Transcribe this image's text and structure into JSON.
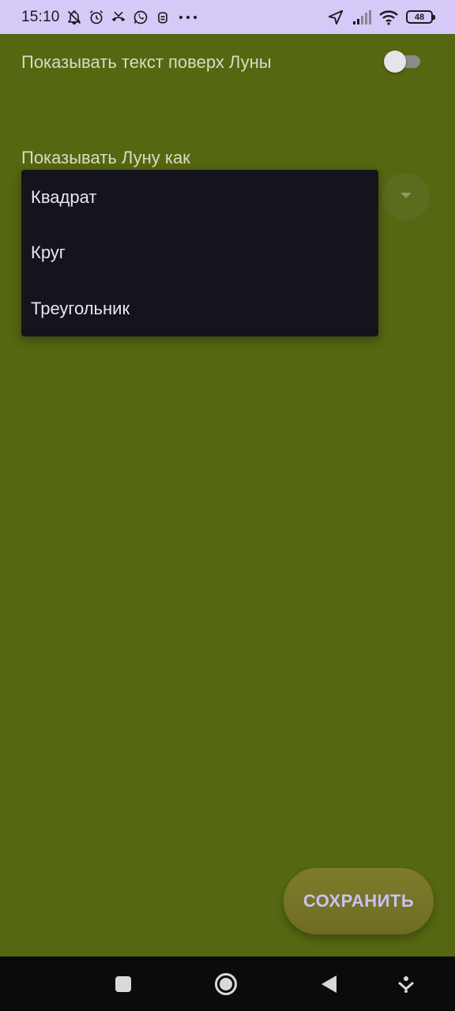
{
  "status_bar": {
    "time": "15:10",
    "battery": "48",
    "left_icons": [
      "bell-off-icon",
      "alarm-icon",
      "missed-call-icon",
      "whatsapp-icon",
      "chat-bot-icon",
      "more-dots-icon"
    ],
    "right_icons": [
      "location-arrow-icon",
      "cell-signal-icon",
      "wifi-icon",
      "battery-icon"
    ]
  },
  "settings": {
    "show_text_over_moon": {
      "label": "Показывать текст поверх Луны",
      "enabled": false
    },
    "show_moon_as": {
      "label": "Показывать Луну как"
    }
  },
  "dropdown": {
    "options": [
      "Квадрат",
      "Круг",
      "Треугольник"
    ]
  },
  "save_button": {
    "label": "СОХРАНИТЬ"
  },
  "nav_bar": {
    "buttons": [
      "recents-square-icon",
      "home-circle-icon",
      "back-triangle-icon",
      "notification-pull-icon"
    ]
  },
  "colors": {
    "background": "#556711",
    "status_bar": "#d7c9f7",
    "menu_background": "#15131b",
    "save_button": "#7e7c2b",
    "save_text": "#c9c2f2"
  }
}
